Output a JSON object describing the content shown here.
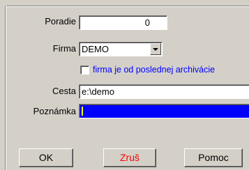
{
  "form": {
    "order": {
      "label": "Poradie",
      "value": "0"
    },
    "firm": {
      "label": "Firma",
      "value": "DEMO"
    },
    "checkbox": {
      "label": "firma je od poslednej archivácie",
      "checked": false
    },
    "path": {
      "label": "Cesta",
      "value": "e:\\demo"
    },
    "note": {
      "label": "Poznámka",
      "value": ""
    }
  },
  "buttons": {
    "ok": "OK",
    "cancel": "Zruš",
    "help": "Pomoc"
  },
  "colors": {
    "window_bg": "#d4d0c8",
    "checkbox_label": "#0000ff",
    "focused_field_bg": "#0000ff",
    "caret": "#ffff00",
    "cancel_text": "#ff0000"
  }
}
